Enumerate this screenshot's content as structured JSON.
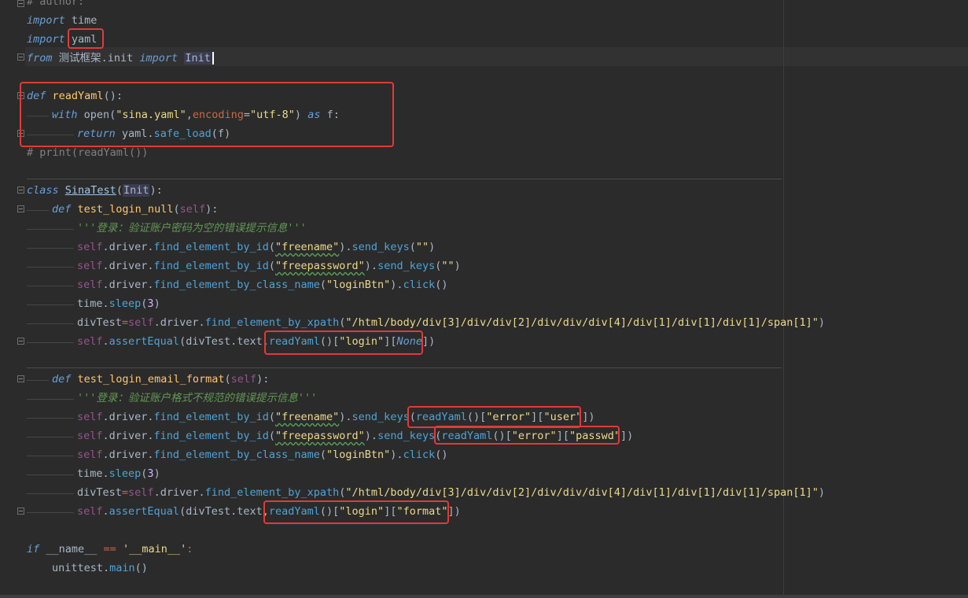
{
  "editor": {
    "language": "python",
    "lines": {
      "l0": "# author:",
      "l1a": "import",
      "l1b": " time",
      "l2a": "import",
      "l2b": "yaml",
      "l3a": "from",
      "l3b": " 测试框架.init ",
      "l3c": "import",
      "l3d": "Init",
      "l5a": "def",
      "l5b": "readYaml",
      "l5c": "():",
      "l6a": "with",
      "l6b": " open(",
      "l6c": "\"sina.yaml\"",
      "l6d": ",",
      "l6e": "encoding",
      "l6f": "=",
      "l6g": "\"utf-8\"",
      "l6h": ") ",
      "l6i": "as",
      "l6j": " f:",
      "l7a": "return",
      "l7b": " yaml.",
      "l7c": "safe_load",
      "l7d": "(f)",
      "l8": "# print(readYaml())",
      "l10a": "class",
      "l10b": "SinaTest",
      "l10c": "(",
      "l10d": "Init",
      "l10e": "):",
      "l11a": "def",
      "l11b": "test_login_null",
      "l11c": "(",
      "l11d": "self",
      "l11e": "):",
      "l12": "'''登录：验证账户密码为空的错误提示信息'''",
      "l13a": "self",
      "l13b": ".driver.",
      "l13c": "find_element_by_id",
      "l13d": "(",
      "l13e": "\"freename\"",
      "l13f": ").",
      "l13g": "send_keys",
      "l13h": "(",
      "l13i": "\"\"",
      "l13j": ")",
      "l14a": "self",
      "l14b": ".driver.",
      "l14c": "find_element_by_id",
      "l14d": "(",
      "l14e": "\"freepassword\"",
      "l14f": ").",
      "l14g": "send_keys",
      "l14h": "(",
      "l14i": "\"\"",
      "l14j": ")",
      "l15a": "self",
      "l15b": ".driver.",
      "l15c": "find_element_by_class_name",
      "l15d": "(",
      "l15e": "\"loginBtn\"",
      "l15f": ").",
      "l15g": "click",
      "l15h": "()",
      "l16a": "time.",
      "l16b": "sleep",
      "l16c": "(",
      "l16d": "3",
      "l16e": ")",
      "l17a": "divTest",
      "l17b": "=",
      "l17c": "self",
      "l17d": ".driver.",
      "l17e": "find_element_by_xpath",
      "l17f": "(",
      "l17g": "\"/html/body/div[3]/div/div[2]/div/div/div[4]/div[1]/div[1]/div[1]/span[1]\"",
      "l17h": ")",
      "l18a": "self",
      "l18b": ".",
      "l18c": "assertEqual",
      "l18d": "(divTest.text,",
      "l18e": "readYaml",
      "l18f": "()[",
      "l18g": "\"login\"",
      "l18h": "][",
      "l18i": "None",
      "l18j": "])",
      "l20a": "def",
      "l20b": "test_login_email_format",
      "l20c": "(",
      "l20d": "self",
      "l20e": "):",
      "l21": "'''登录：验证账户格式不规范的错误提示信息'''",
      "l22a": "self",
      "l22b": ".driver.",
      "l22c": "find_element_by_id",
      "l22d": "(",
      "l22e": "\"freename\"",
      "l22f": ").",
      "l22g": "send_keys",
      "l22h": "(",
      "l22i": "readYaml",
      "l22j": "()[",
      "l22k": "\"error\"",
      "l22l": "][",
      "l22m": "\"user\"",
      "l22n": "])",
      "l23a": "self",
      "l23b": ".driver.",
      "l23c": "find_element_by_id",
      "l23d": "(",
      "l23e": "\"freepassword\"",
      "l23f": ").",
      "l23g": "send_keys",
      "l23h": "(",
      "l23i": "readYaml",
      "l23j": "()[",
      "l23k": "\"error\"",
      "l23l": "][",
      "l23m": "\"passwd\"",
      "l23n": "])",
      "l24a": "self",
      "l24b": ".driver.",
      "l24c": "find_element_by_class_name",
      "l24d": "(",
      "l24e": "\"loginBtn\"",
      "l24f": ").",
      "l24g": "click",
      "l24h": "()",
      "l25a": "time.",
      "l25b": "sleep",
      "l25c": "(",
      "l25d": "3",
      "l25e": ")",
      "l26a": "divTest",
      "l26b": "=",
      "l26c": "self",
      "l26d": ".driver.",
      "l26e": "find_element_by_xpath",
      "l26f": "(",
      "l26g": "\"/html/body/div[3]/div/div[2]/div/div/div[4]/div[1]/div[1]/div[1]/span[1]\"",
      "l26h": ")",
      "l27a": "self",
      "l27b": ".",
      "l27c": "assertEqual",
      "l27d": "(divTest.text,",
      "l27e": "readYaml",
      "l27f": "()[",
      "l27g": "\"login\"",
      "l27h": "][",
      "l27i": "\"format\"",
      "l27j": "])",
      "l29a": "if",
      "l29b": " __name__ ",
      "l29c": "==",
      "l29d": " ",
      "l29e": "'__main__'",
      "l29f": ":",
      "l30a": "unittest.",
      "l30b": "main",
      "l30c": "()"
    }
  },
  "colors": {
    "background": "#2b2b2b",
    "keyword": "#6a9fd8",
    "function": "#ffc66d",
    "string": "#ecd98b",
    "annotation_box": "#e03a3a"
  }
}
